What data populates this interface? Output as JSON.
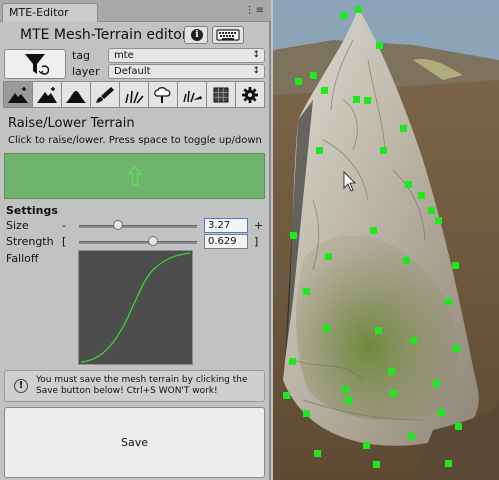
{
  "window": {
    "tab_title": "MTE-Editor",
    "tab_menu": "⋮≡"
  },
  "header": {
    "title": "MTE Mesh-Terrain editor",
    "info_glyph": "i"
  },
  "filter": {
    "tag_label": "tag",
    "tag_value": "mte",
    "layer_label": "layer",
    "layer_value": "Default"
  },
  "toolbar": {
    "tools": [
      {
        "name": "raise-lower",
        "icon": "mountain-plus-icon",
        "active": true
      },
      {
        "name": "paint-height",
        "icon": "mountain-plus-icon"
      },
      {
        "name": "smooth",
        "icon": "mountain-icon"
      },
      {
        "name": "paint-texture",
        "icon": "brush-icon"
      },
      {
        "name": "grass",
        "icon": "grass-icon"
      },
      {
        "name": "trees",
        "icon": "tree-icon"
      },
      {
        "name": "grass-detail",
        "icon": "grass-detail-icon"
      },
      {
        "name": "texture-convert",
        "icon": "grid-icon"
      },
      {
        "name": "settings",
        "icon": "gear-icon"
      }
    ]
  },
  "tool": {
    "title": "Raise/Lower Terrain",
    "hint": "Click to raise/lower. Press space to toggle up/down"
  },
  "settings": {
    "heading": "Settings",
    "size": {
      "label": "Size",
      "left_mark": "-",
      "right_mark": "+",
      "value": "3.27",
      "fraction": 0.33
    },
    "strength": {
      "label": "Strength",
      "left_mark": "[",
      "right_mark": "]",
      "value": "0.629",
      "fraction": 0.629
    },
    "falloff_label": "Falloff"
  },
  "note": {
    "icon": "!",
    "text": "You must save the mesh terrain by clicking the Save button below! Ctrl+S WON'T work!"
  },
  "save": {
    "label": "Save"
  },
  "colors": {
    "preview_green": "#6fb36f",
    "curve_green": "#2ee02e",
    "active_tab": "#9a9a9a",
    "vertex_green": "#1ee81e"
  }
}
